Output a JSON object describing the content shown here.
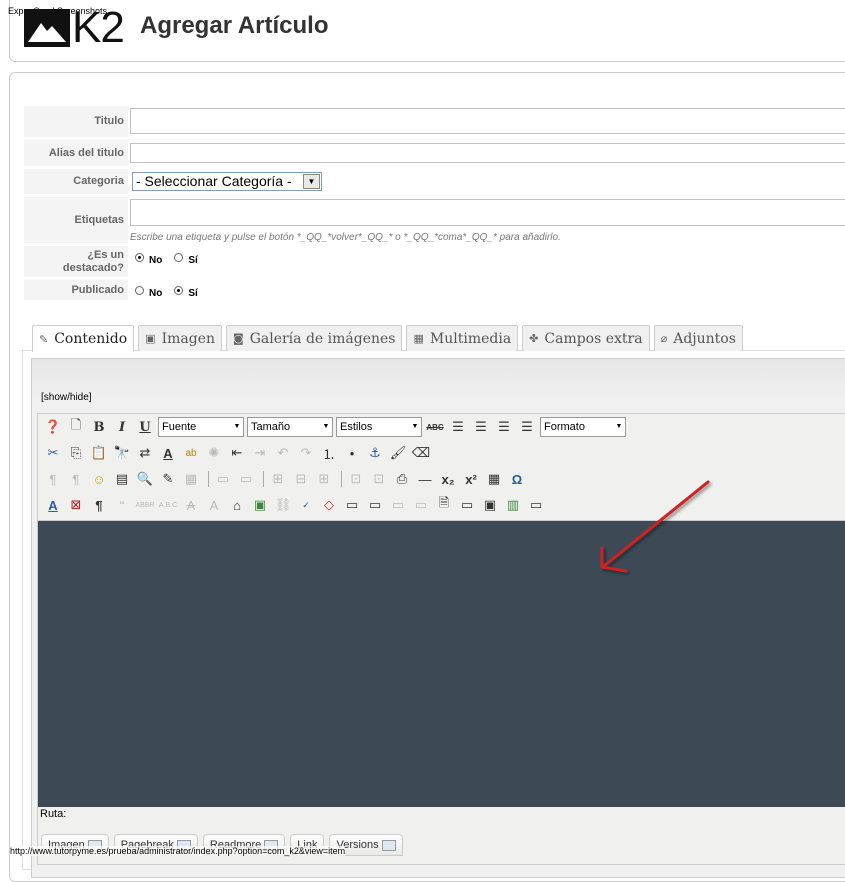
{
  "caption": "Exp... Send Screenshots",
  "status_url": "http://www.tutorpyme.es/prueba/administrator/index.php?option=com_k2&view=item",
  "logo": {
    "text": "K2"
  },
  "page_title": "Agregar Artículo",
  "form": {
    "titulo": {
      "label": "Titulo",
      "value": ""
    },
    "alias": {
      "label": "Alias del titulo",
      "value": ""
    },
    "categoria": {
      "label": "Categoria",
      "selected": "- Seleccionar Categoría -"
    },
    "etiquetas": {
      "label": "Etiquetas",
      "value": "",
      "hint": "Escribe una etiqueta y pulse el botón *_QQ_*volver*_QQ_* o *_QQ_*coma*_QQ_* para añadirlo."
    },
    "destacado": {
      "label": "¿Es un destacado?",
      "options": [
        "No",
        "Sí"
      ],
      "selected": "No"
    },
    "publicado": {
      "label": "Publicado",
      "options": [
        "No",
        "Sí"
      ],
      "selected": "Sí"
    }
  },
  "tabs": [
    {
      "label": "Contenido",
      "icon": "edit-icon",
      "active": true
    },
    {
      "label": "Imagen",
      "icon": "image-icon",
      "active": false
    },
    {
      "label": "Galería de imágenes",
      "icon": "camera-icon",
      "active": false
    },
    {
      "label": "Multimedia",
      "icon": "film-icon",
      "active": false
    },
    {
      "label": "Campos extra",
      "icon": "puzzle-icon",
      "active": false
    },
    {
      "label": "Adjuntos",
      "icon": "paperclip-icon",
      "active": false
    }
  ],
  "editor": {
    "show_hide": "[show/hide]",
    "font_select": "Fuente",
    "size_select": "Tamaño",
    "styles_select": "Estilos",
    "format_select": "Formato",
    "path_label": "Ruta:",
    "buttons": [
      "Imagen",
      "Pagebreak",
      "Readmore",
      "Link",
      "Versions"
    ]
  },
  "colors": {
    "edit_area": "#3d4a56",
    "arrow": "#cc2222"
  }
}
